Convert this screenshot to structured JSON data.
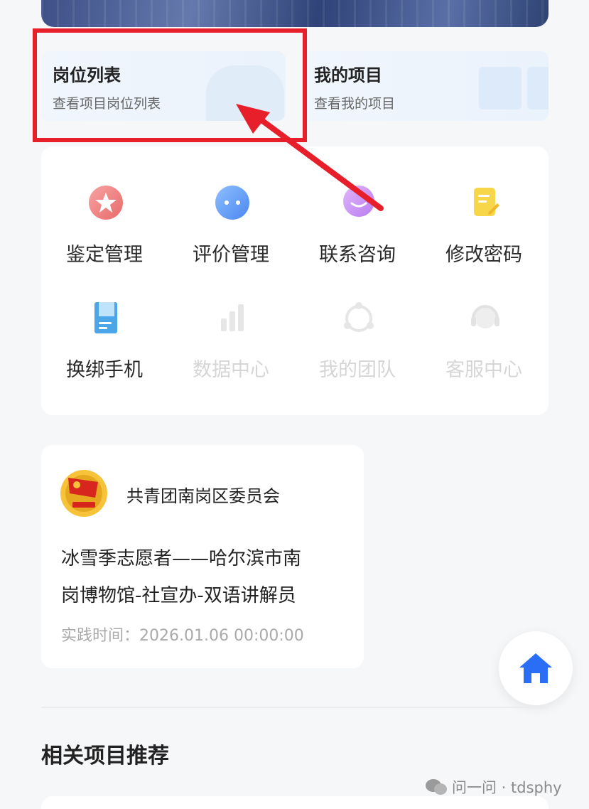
{
  "quick_links": [
    {
      "title": "岗位列表",
      "subtitle": "查看项目岗位列表"
    },
    {
      "title": "我的项目",
      "subtitle": "查看我的项目"
    }
  ],
  "menu": [
    {
      "label": "鉴定管理",
      "icon": "star-badge-icon",
      "enabled": true
    },
    {
      "label": "评价管理",
      "icon": "chat-bubble-icon",
      "enabled": true
    },
    {
      "label": "联系咨询",
      "icon": "message-icon",
      "enabled": true
    },
    {
      "label": "修改密码",
      "icon": "edit-document-icon",
      "enabled": true
    },
    {
      "label": "换绑手机",
      "icon": "notebook-icon",
      "enabled": true
    },
    {
      "label": "数据中心",
      "icon": "bar-chart-icon",
      "enabled": false
    },
    {
      "label": "我的团队",
      "icon": "team-icon",
      "enabled": false
    },
    {
      "label": "客服中心",
      "icon": "headset-icon",
      "enabled": false
    }
  ],
  "project": {
    "org": "共青团南岗区委员会",
    "title_line1": "冰雪季志愿者——哈尔滨市南",
    "title_line2": "岗博物馆-社宣办-双语讲解员",
    "time": "实践时间：2026.01.06 00:00:00"
  },
  "section_title": "相关项目推荐",
  "watermark": "问一问 · tdsphy",
  "colors": {
    "highlight": "#e61f2b",
    "home_icon": "#2a6ef5"
  }
}
